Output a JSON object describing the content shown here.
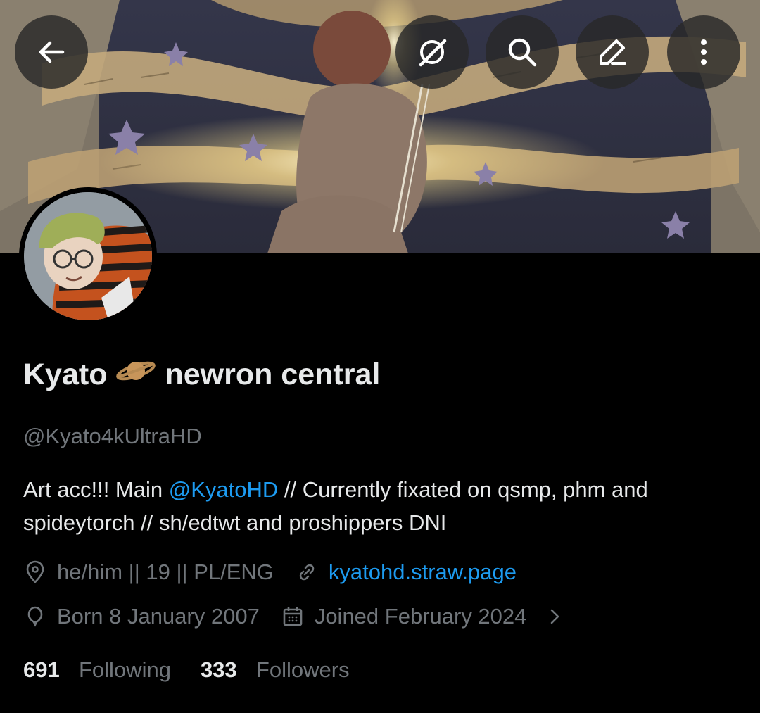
{
  "header": {
    "back_icon": "arrow-left-icon",
    "grok_icon": "grok-icon",
    "search_icon": "search-icon",
    "edit_icon": "edit-pencil-icon",
    "more_icon": "more-vertical-icon"
  },
  "profile": {
    "name_part1": "Kyato",
    "name_emoji": "ringed-planet-emoji",
    "name_part2": "newron central",
    "handle": "@Kyato4kUltraHD",
    "bio": {
      "before_mention": "Art acc!!! Main ",
      "mention": "@KyatoHD",
      "after_mention": " // Currently fixated on qsmp, phm and spideytorch // sh/edtwt and proshippers DNI"
    },
    "location": "he/him || 19 || PL/ENG",
    "website": "kyatohd.straw.page",
    "birthday": "Born 8 January 2007",
    "joined": "Joined February 2024",
    "following_count": "691",
    "following_label": "Following",
    "followers_count": "333",
    "followers_label": "Followers"
  },
  "colors": {
    "background": "#000000",
    "text_primary": "#e7e9ea",
    "text_secondary": "#71767b",
    "link": "#1d9bf0"
  }
}
